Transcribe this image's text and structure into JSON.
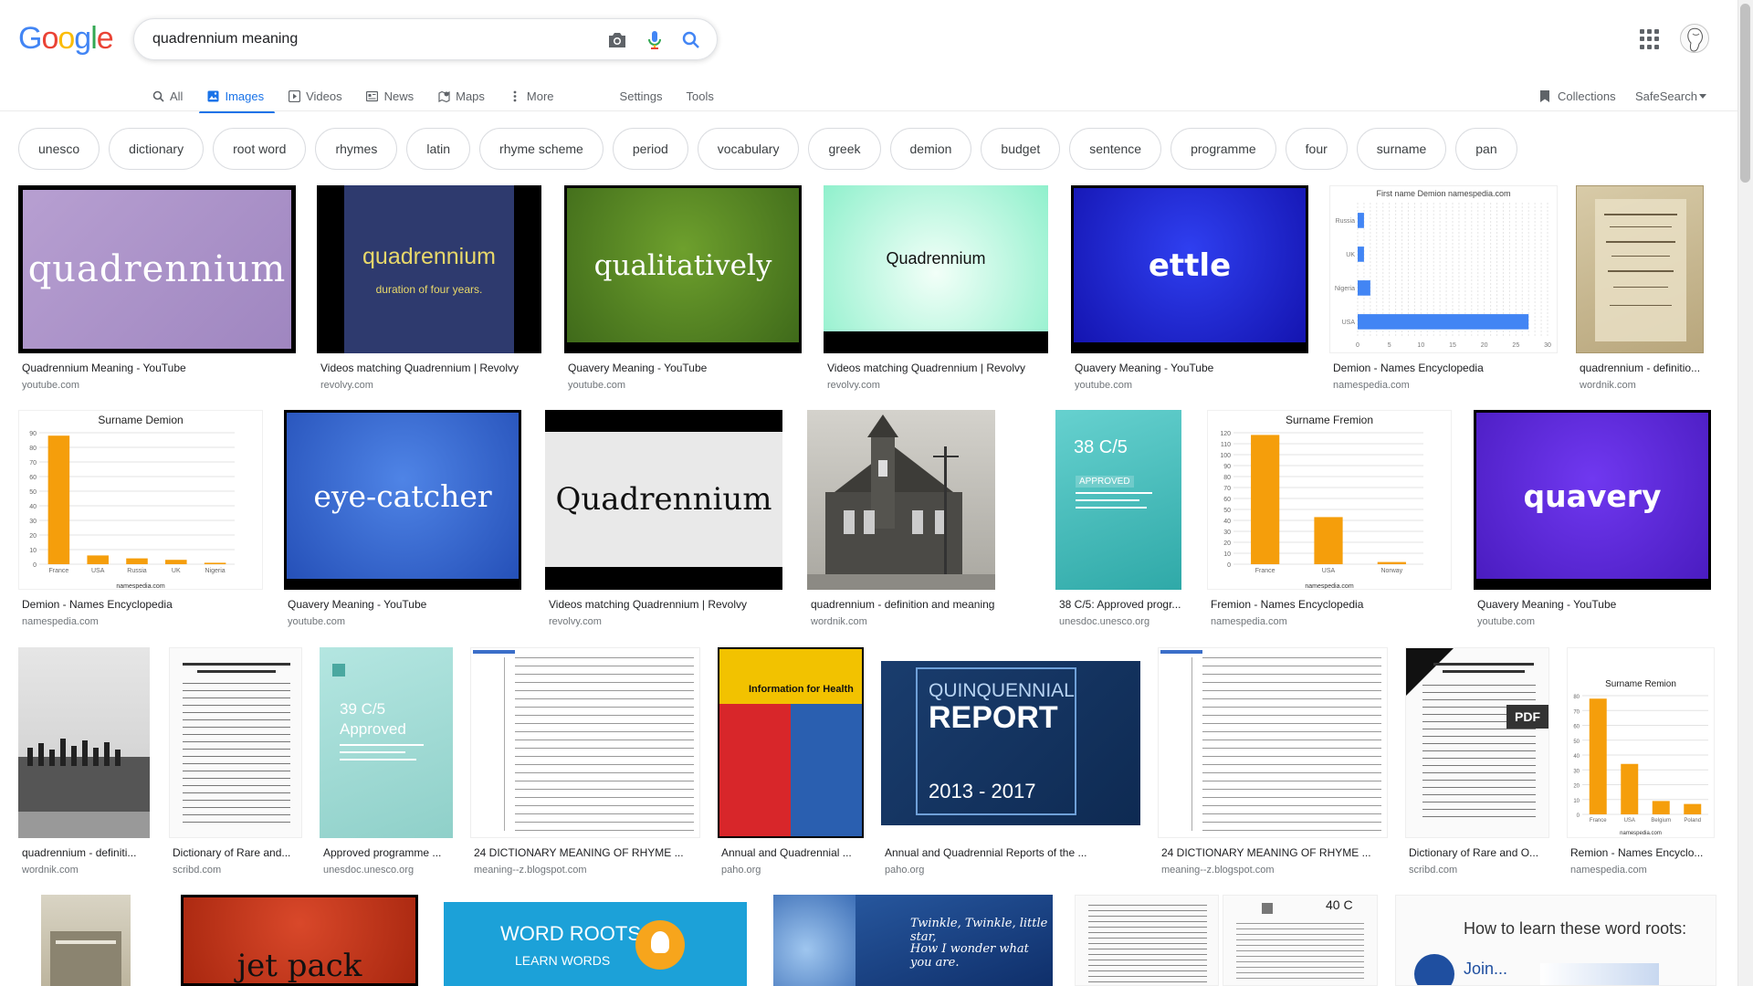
{
  "logo": "Google",
  "search": {
    "query": "quadrennium meaning"
  },
  "tabs": [
    {
      "label": "All",
      "icon": "search-icon",
      "active": false
    },
    {
      "label": "Images",
      "icon": "image-icon",
      "active": true
    },
    {
      "label": "Videos",
      "icon": "play-icon",
      "active": false
    },
    {
      "label": "News",
      "icon": "news-icon",
      "active": false
    },
    {
      "label": "Maps",
      "icon": "map-pin-icon",
      "active": false
    },
    {
      "label": "More",
      "icon": "more-vert-icon",
      "active": false
    }
  ],
  "settings_label": "Settings",
  "tools_label": "Tools",
  "collections_label": "Collections",
  "safesearch_label": "SafeSearch",
  "chips": [
    "unesco",
    "dictionary",
    "root word",
    "rhymes",
    "latin",
    "rhyme scheme",
    "period",
    "vocabulary",
    "greek",
    "demion",
    "budget",
    "sentence",
    "programme",
    "four",
    "surname",
    "pan"
  ],
  "thumb_text": {
    "r1": [
      "quadrennium",
      "quadrennium",
      "duration of four years.",
      "qualitatively",
      "Quadrennium",
      "ettle"
    ],
    "r2": [
      "eye-catcher",
      "Quadrennium",
      "38 C/5",
      "APPROVED",
      "quavery"
    ],
    "r3": [
      "39 C/5",
      "Approved",
      "Information for Health",
      "QUINQUENNIAL",
      "REPORT",
      "2013 - 2017",
      "PDF"
    ],
    "r4": [
      "jet pack",
      "WORD ROOTS",
      "LEARN WORDS",
      "Twinkle, Twinkle, little star,",
      "How I wonder what you are.",
      "40 C",
      "How to learn these word roots:",
      "Join..."
    ]
  },
  "chart_labels": {
    "demion_names": "First name Demion namespedia.com",
    "surname_demion": "Surname Demion",
    "surname_fremion": "Surname Fremion",
    "surname_remion": "Surname Remion",
    "namespedia": "namespedia.com"
  },
  "results": [
    {
      "title": "Quadrennium Meaning - YouTube",
      "site": "youtube.com"
    },
    {
      "title": "Videos matching Quadrennium | Revolvy",
      "site": "revolvy.com"
    },
    {
      "title": "Quavery Meaning - YouTube",
      "site": "youtube.com"
    },
    {
      "title": "Videos matching Quadrennium | Revolvy",
      "site": "revolvy.com"
    },
    {
      "title": "Quavery Meaning - YouTube",
      "site": "youtube.com"
    },
    {
      "title": "Demion - Names Encyclopedia",
      "site": "namespedia.com"
    },
    {
      "title": "quadrennium - definitio...",
      "site": "wordnik.com"
    },
    {
      "title": "Demion - Names Encyclopedia",
      "site": "namespedia.com"
    },
    {
      "title": "Quavery Meaning - YouTube",
      "site": "youtube.com"
    },
    {
      "title": "Videos matching Quadrennium | Revolvy",
      "site": "revolvy.com"
    },
    {
      "title": "quadrennium - definition and meaning",
      "site": "wordnik.com"
    },
    {
      "title": "38 C/5: Approved progr...",
      "site": "unesdoc.unesco.org"
    },
    {
      "title": "Fremion - Names Encyclopedia",
      "site": "namespedia.com"
    },
    {
      "title": "Quavery Meaning - YouTube",
      "site": "youtube.com"
    },
    {
      "title": "quadrennium - definiti...",
      "site": "wordnik.com"
    },
    {
      "title": "Dictionary of Rare and...",
      "site": "scribd.com"
    },
    {
      "title": "Approved programme ...",
      "site": "unesdoc.unesco.org"
    },
    {
      "title": "24 DICTIONARY MEANING OF RHYME ...",
      "site": "meaning--z.blogspot.com"
    },
    {
      "title": "Annual and Quadrennial ...",
      "site": "paho.org"
    },
    {
      "title": "Annual and Quadrennial Reports of the ...",
      "site": "paho.org"
    },
    {
      "title": "24 DICTIONARY MEANING OF RHYME ...",
      "site": "meaning--z.blogspot.com"
    },
    {
      "title": "Dictionary of Rare and O...",
      "site": "scribd.com"
    },
    {
      "title": "Remion - Names Encyclo...",
      "site": "namespedia.com"
    }
  ],
  "chart_data": [
    {
      "type": "bar",
      "title": "Surname Demion",
      "categories": [
        "France",
        "USA",
        "Russia",
        "UK",
        "Nigeria"
      ],
      "values": [
        88,
        6,
        4,
        3,
        1
      ],
      "ylim": [
        0,
        90
      ]
    },
    {
      "type": "bar",
      "title": "Surname Fremion",
      "categories": [
        "France",
        "USA",
        "Norway"
      ],
      "values": [
        118,
        43,
        2
      ],
      "ylim": [
        0,
        120
      ]
    },
    {
      "type": "bar",
      "title": "Surname Remion",
      "categories": [
        "France",
        "USA",
        "Belgium",
        "Poland"
      ],
      "values": [
        78,
        34,
        9,
        7
      ],
      "ylim": [
        0,
        80
      ]
    },
    {
      "type": "bar",
      "title": "First name Demion namespedia.com",
      "categories": [
        "Russia",
        "UK",
        "Nigeria",
        "USA"
      ],
      "values": [
        1,
        1,
        2,
        27
      ],
      "xlim": [
        0,
        30
      ]
    }
  ]
}
